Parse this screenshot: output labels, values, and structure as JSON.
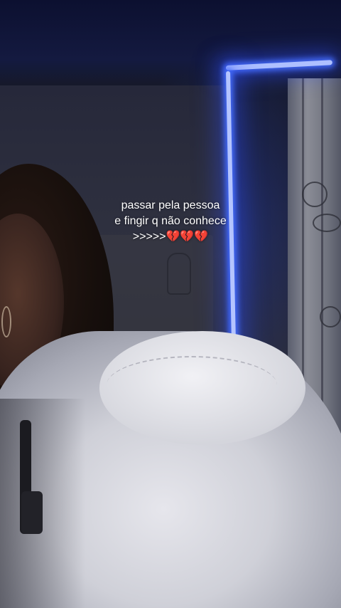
{
  "story": {
    "caption": {
      "line1": "passar pela pessoa",
      "line2": "e fingir q não conhece",
      "line3": ">>>>>💔💔💔"
    }
  },
  "colors": {
    "led_light": "#aec0ff",
    "caption_text": "#ffffff"
  }
}
